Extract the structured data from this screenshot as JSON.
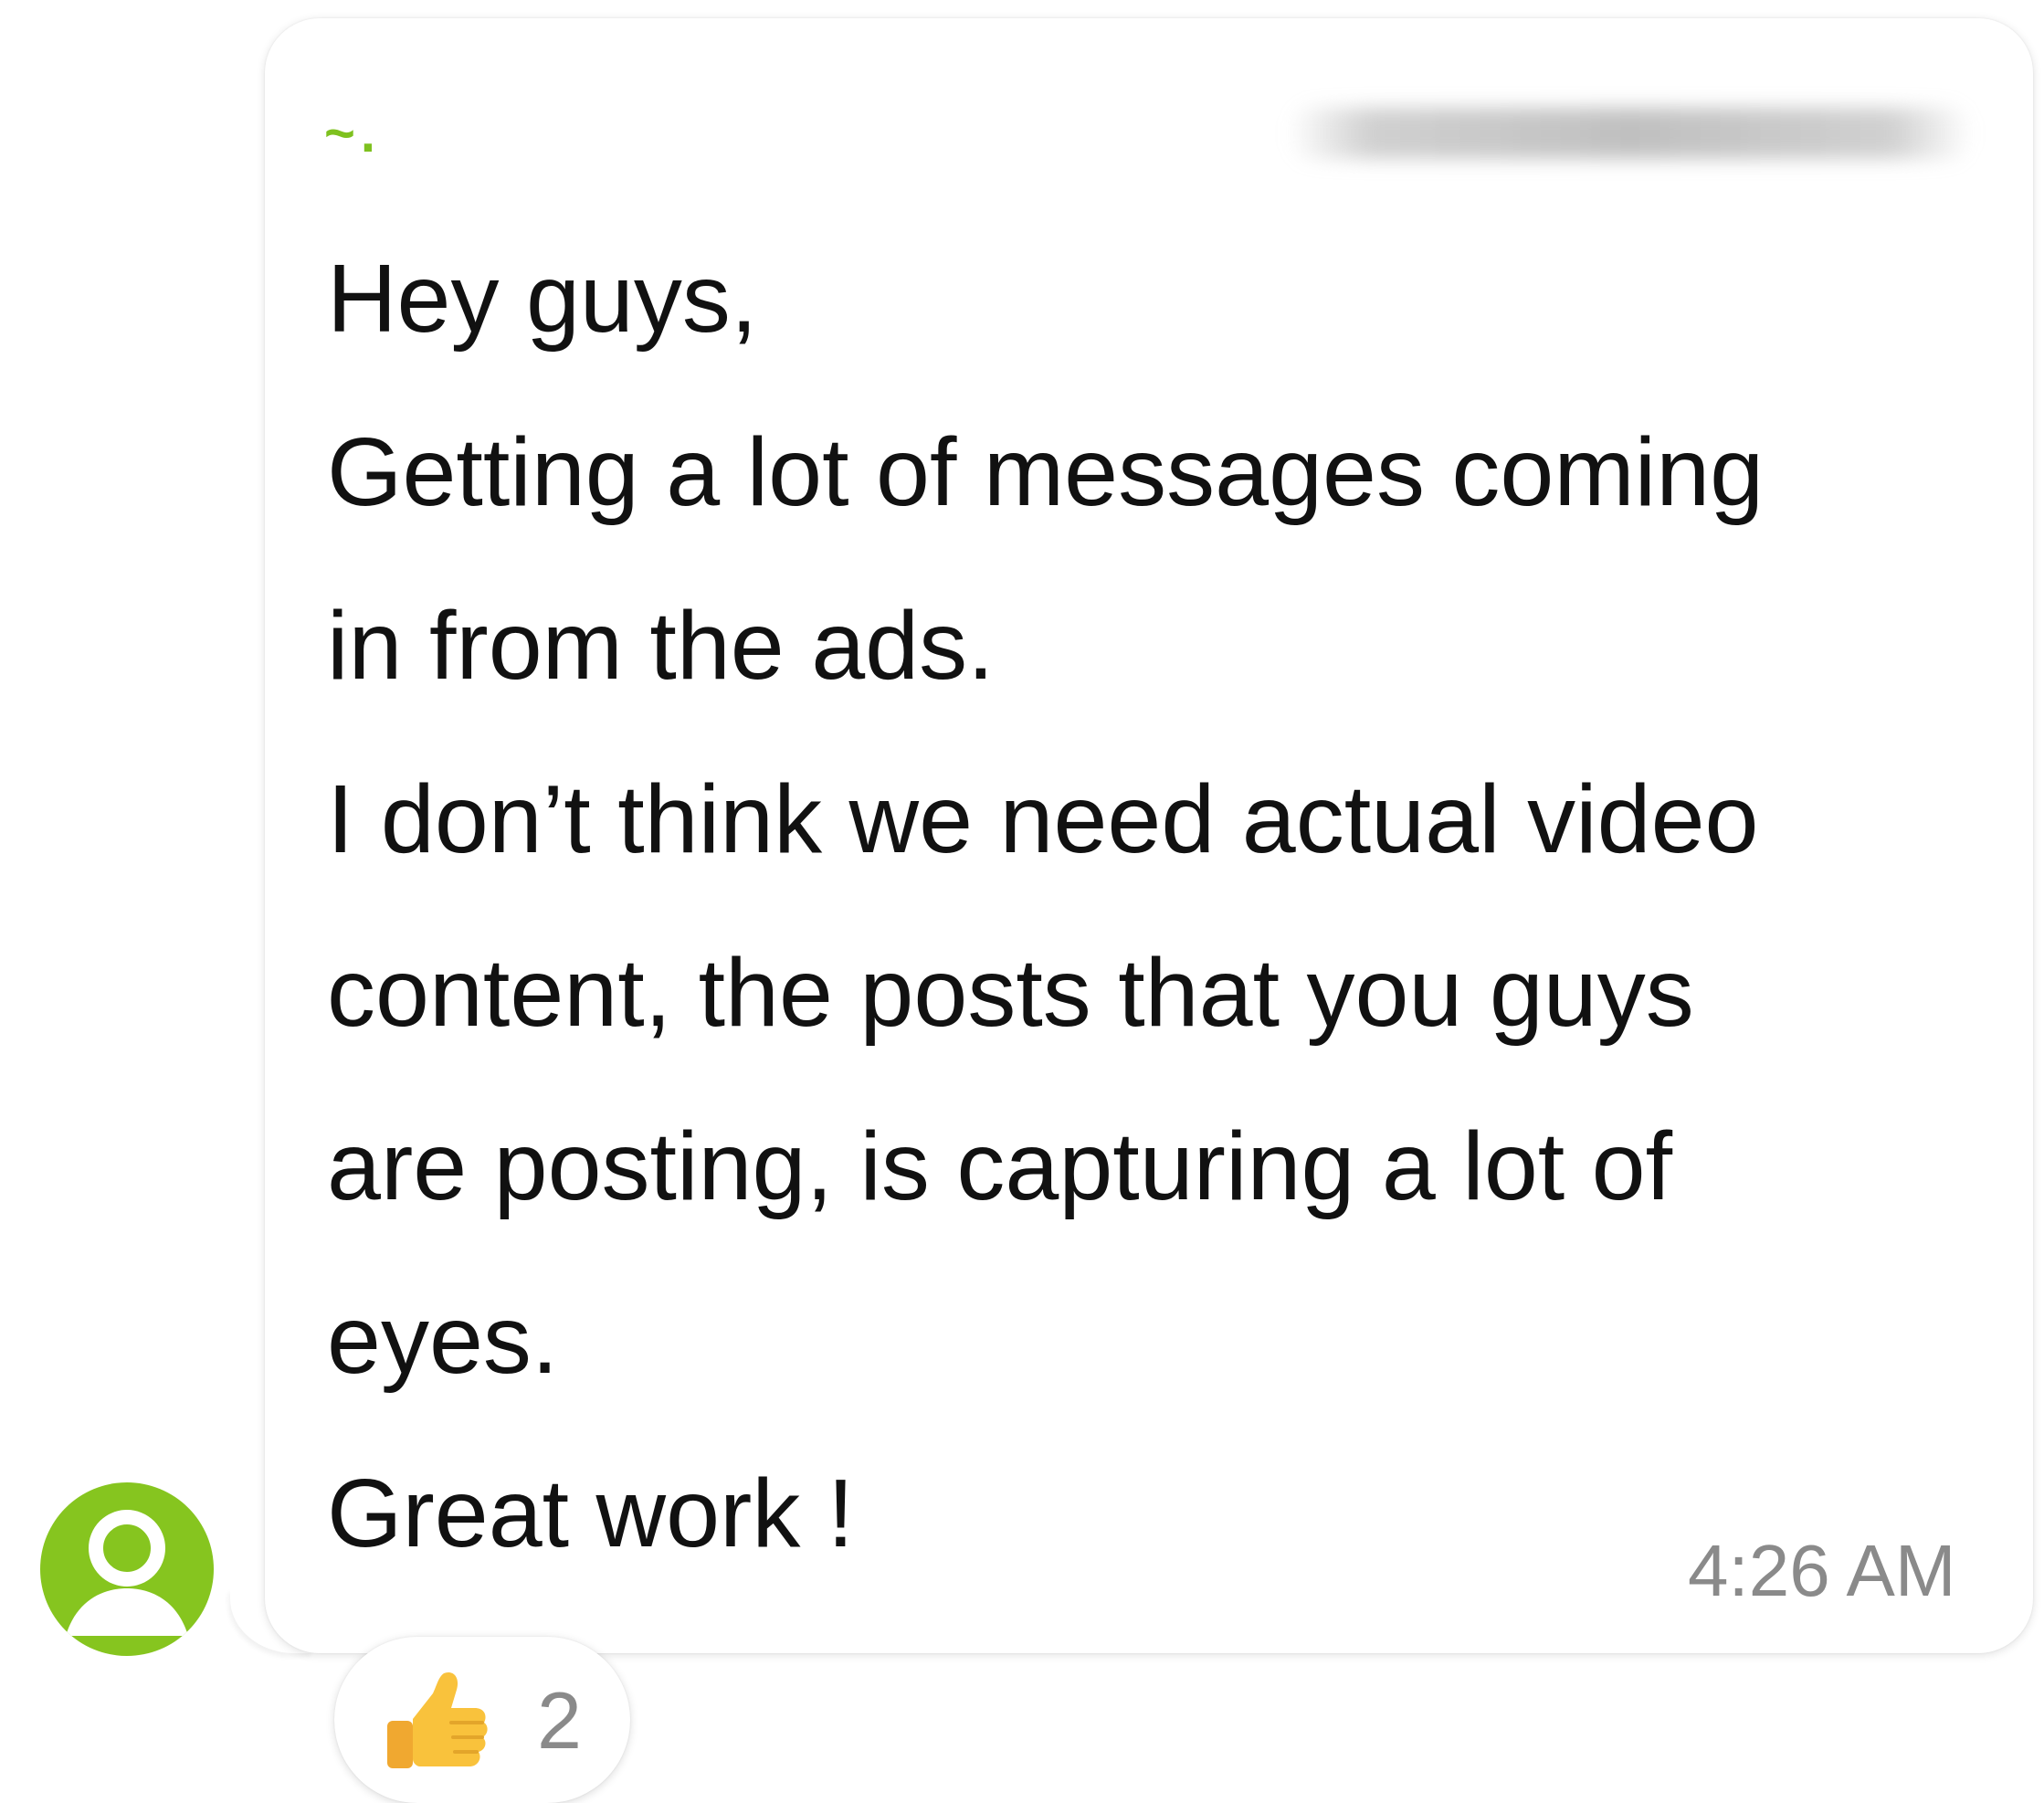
{
  "message": {
    "sender_name": "~.",
    "lines": [
      "Hey guys,",
      "Getting a lot of messages coming",
      "in from the ads.",
      "I don’t think we need actual video",
      "content, the posts that you guys",
      "are posting, is capturing a lot of",
      "eyes.",
      "Great work !"
    ],
    "timestamp": "4:26 AM"
  },
  "reaction": {
    "emoji_icon": "thumbs-up-icon",
    "count": "2"
  },
  "avatar": {
    "icon": "person-icon",
    "color": "#86c51f"
  },
  "colors": {
    "sender": "#7ec11f",
    "timestamp": "#8a8a8a",
    "text": "#111111"
  }
}
